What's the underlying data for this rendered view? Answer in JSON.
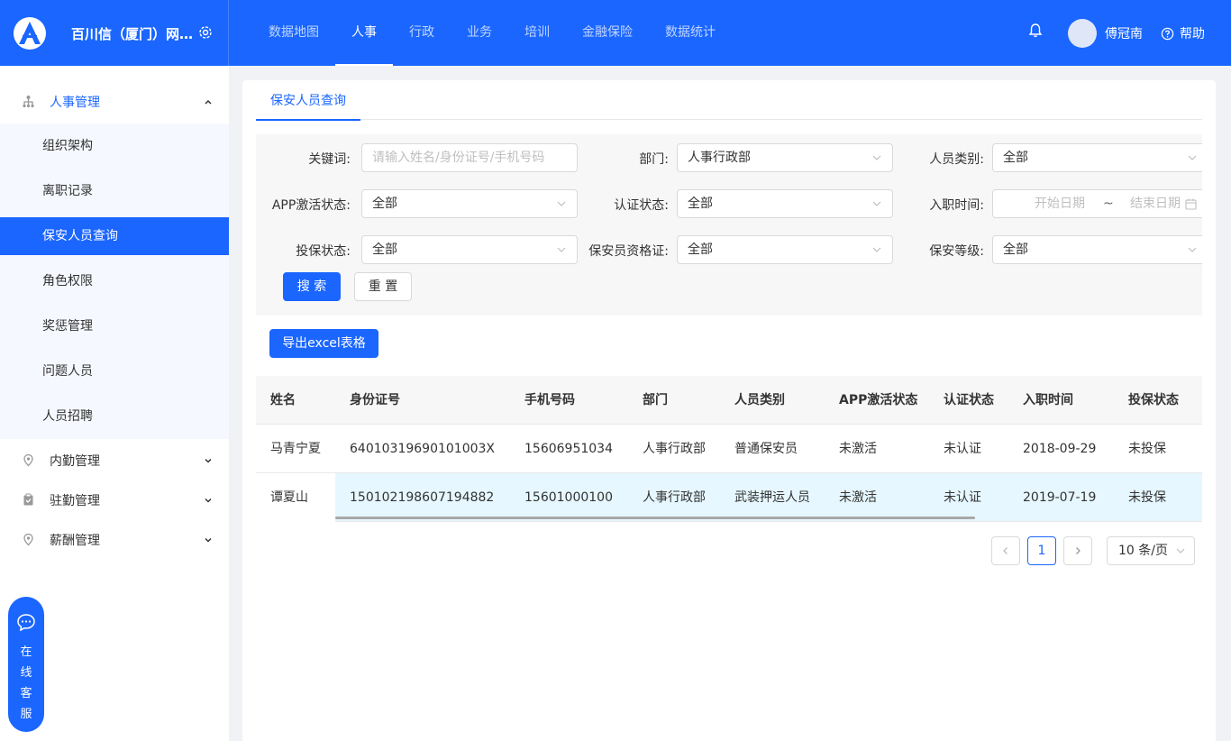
{
  "header": {
    "app_title": "百川信（厦门）网络科技有限公司",
    "nav": [
      {
        "label": "数据地图",
        "active": false
      },
      {
        "label": "人事",
        "active": true
      },
      {
        "label": "行政",
        "active": false
      },
      {
        "label": "业务",
        "active": false
      },
      {
        "label": "培训",
        "active": false
      },
      {
        "label": "金融保险",
        "active": false
      },
      {
        "label": "数据统计",
        "active": false
      }
    ],
    "username": "傅冠南",
    "help_label": "帮助"
  },
  "sidebar": {
    "hr_group": "人事管理",
    "hr_items": [
      "组织架构",
      "离职记录",
      "保安人员查询",
      "角色权限",
      "奖惩管理",
      "问题人员",
      "人员招聘"
    ],
    "active_item": "保安人员查询",
    "groups": [
      "内勤管理",
      "驻勤管理",
      "薪酬管理"
    ]
  },
  "chat": {
    "label": "在线客服",
    "chars": [
      "在",
      "线",
      "客",
      "服"
    ]
  },
  "content": {
    "tab": "保安人员查询",
    "filters": {
      "keyword_label": "关键词:",
      "keyword_placeholder": "请输入姓名/身份证号/手机号码",
      "dept_label": "部门:",
      "dept_value": "人事行政部",
      "category_label": "人员类别:",
      "category_value": "全部",
      "app_label": "APP激活状态:",
      "app_value": "全部",
      "auth_label": "认证状态:",
      "auth_value": "全部",
      "join_label": "入职时间:",
      "start_placeholder": "开始日期",
      "range_sep": "~",
      "end_placeholder": "结束日期",
      "insure_label": "投保状态:",
      "insure_value": "全部",
      "cert_label": "保安员资格证:",
      "cert_value": "全部",
      "level_label": "保安等级:",
      "level_value": "全部"
    },
    "search_btn": "搜 索",
    "reset_btn": "重 置",
    "export_btn": "导出excel表格"
  },
  "table": {
    "columns": [
      "姓名",
      "身份证号",
      "手机号码",
      "部门",
      "人员类别",
      "APP激活状态",
      "认证状态",
      "入职时间",
      "投保状态"
    ],
    "rows": [
      [
        "马青宁夏",
        "64010319690101003X",
        "15606951034",
        "人事行政部",
        "普通保安员",
        "未激活",
        "未认证",
        "2018-09-29",
        "未投保"
      ],
      [
        "谭夏山",
        "150102198607194882",
        "15601000100",
        "人事行政部",
        "武装押运人员",
        "未激活",
        "未认证",
        "2019-07-19",
        "未投保"
      ]
    ]
  },
  "pagination": {
    "current": "1",
    "page_size": "10 条/页"
  },
  "colors": {
    "primary": "#1a66ff",
    "highlight_row": "#e6f7ff"
  },
  "icons": [
    "logo-icon",
    "gear-icon",
    "bell-icon",
    "help-icon",
    "org-icon",
    "location-icon",
    "clipboard-icon",
    "chevron-up-icon",
    "chevron-down-icon",
    "chat-icon",
    "calendar-icon"
  ]
}
